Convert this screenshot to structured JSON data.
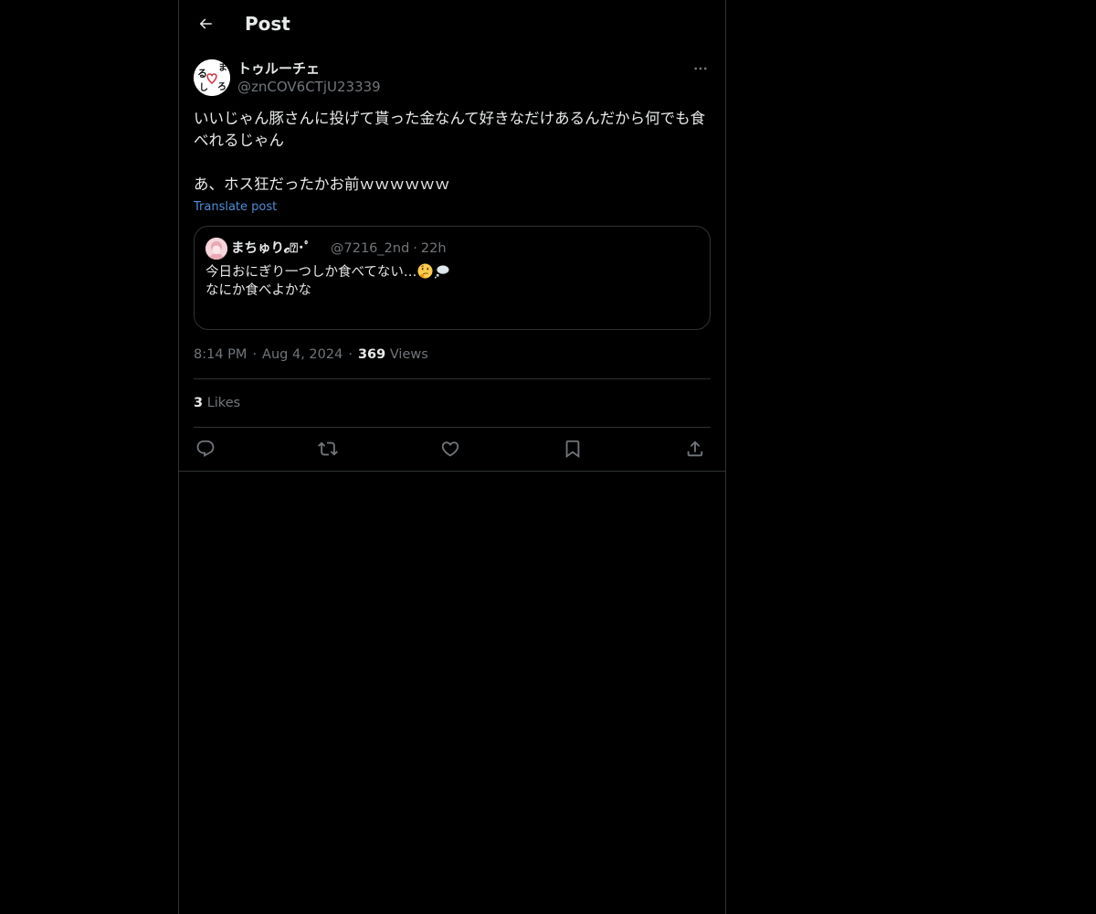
{
  "header": {
    "title": "Post",
    "back_icon": "arrow-left-icon"
  },
  "post": {
    "author": {
      "display_name": "トゥルーチェ",
      "handle": "@znCOV6CTjU23339",
      "avatar_icon": "avatar-image"
    },
    "more_icon": "more-horizontal-icon",
    "text": "いいじゃん豚さんに投げて貰った金なんて好きなだけあるんだから何でも食べれるじゃん\n\nあ、ホス狂だったかお前ｗｗｗｗｗｗ",
    "translate_label": "Translate post",
    "quote": {
      "display_name": "まちゅり𝓬⍰･ﾟ",
      "handle": "@7216_2nd",
      "separator": "·",
      "time": "22h",
      "line1": "今日おにぎり一つしか食べてない…",
      "line1_emojis": [
        "thinking-face-icon",
        "thought-balloon-icon"
      ],
      "line2": "なにか食べよかな"
    },
    "time": "8:14 PM",
    "date": "Aug 4, 2024",
    "separator": "·",
    "views_count": "369",
    "views_label": "Views",
    "likes_count": "3",
    "likes_label": "Likes"
  },
  "actions": [
    {
      "name": "reply",
      "icon": "reply-icon"
    },
    {
      "name": "repost",
      "icon": "repost-icon"
    },
    {
      "name": "like",
      "icon": "heart-icon"
    },
    {
      "name": "bookmark",
      "icon": "bookmark-icon"
    },
    {
      "name": "share",
      "icon": "share-icon"
    }
  ],
  "colors": {
    "background": "#000000",
    "text_primary": "#e7e9ea",
    "text_secondary": "#71767b",
    "border": "#2f3336",
    "link": "#4e8ed8"
  }
}
